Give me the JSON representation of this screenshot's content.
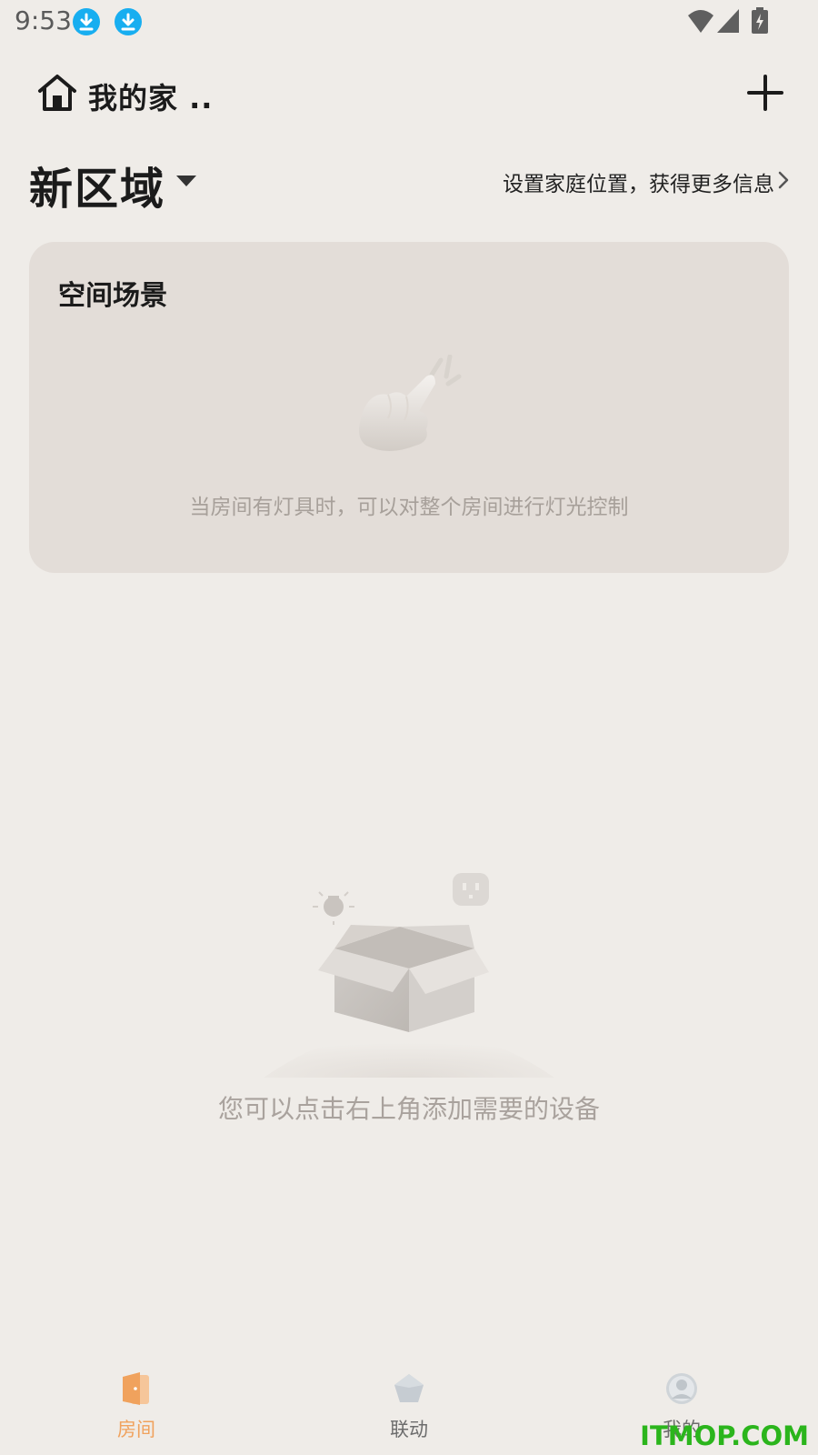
{
  "status_bar": {
    "time": "9:53",
    "icons": [
      "download-icon",
      "download-icon",
      "wifi-icon",
      "signal-icon",
      "battery-charging-icon"
    ]
  },
  "header": {
    "home_icon": "home-icon",
    "home_name": "我的家 ..",
    "add_icon": "plus-icon"
  },
  "area": {
    "name": "新区域",
    "caret_icon": "caret-down-icon",
    "location_link": "设置家庭位置，获得更多信息",
    "chevron_icon": "chevron-right-icon"
  },
  "scene_card": {
    "title": "空间场景",
    "illustration": "tap-hand-icon",
    "hint": "当房间有灯具时，可以对整个房间进行灯光控制"
  },
  "empty_state": {
    "illustration": "open-box-illustration",
    "hint": "您可以点击右上角添加需要的设备"
  },
  "bottom_nav": {
    "tabs": [
      {
        "label": "房间",
        "icon": "door-icon",
        "active": true
      },
      {
        "label": "联动",
        "icon": "pentagon-icon",
        "active": false
      },
      {
        "label": "我的",
        "icon": "user-icon",
        "active": false
      }
    ]
  },
  "watermark": "ITMOP.COM",
  "colors": {
    "background": "#efece8",
    "card": "#e3ddd8",
    "accent": "#f0a25d",
    "download_badge": "#18aef0",
    "watermark": "#2bb51c"
  }
}
